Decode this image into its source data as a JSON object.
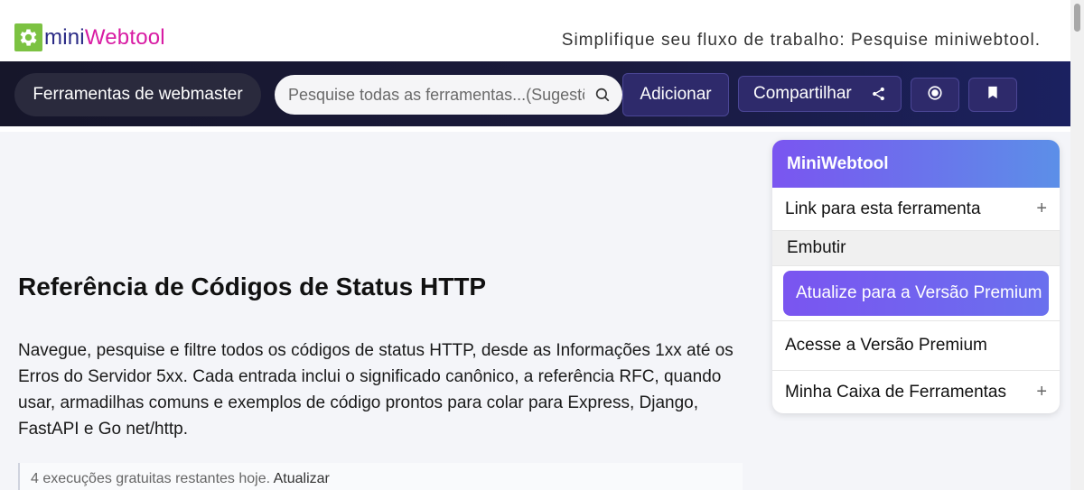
{
  "header": {
    "logo_mini": "mini",
    "logo_web": "Webtool",
    "tagline": "Simplifique seu fluxo de trabalho: Pesquise miniwebtool."
  },
  "navbar": {
    "category_label": "Ferramentas de webmaster",
    "search_placeholder": "Pesquise todas as ferramentas...(Sugestões)",
    "add_label": "Adicionar",
    "share_label": "Compartilhar"
  },
  "main": {
    "title": "Referência de Códigos de Status HTTP",
    "intro": "Navegue, pesquise e filtre todos os códigos de status HTTP, desde as Informações 1xx até os Erros do Servidor 5xx. Cada entrada inclui o significado canônico, a referência RFC, quando usar, armadilhas comuns e exemplos de código prontos para colar para Express, Django, FastAPI e Go net/http.",
    "notice_text": "4 execuções gratuitas restantes hoje.",
    "notice_link": "Atualizar"
  },
  "sidebar": {
    "title": "MiniWebtool",
    "link_label": "Link para esta ferramenta",
    "embed_label": "Embutir",
    "upgrade_label": "Atualize para a Versão Premium",
    "access_label": "Acesse a Versão Premium",
    "toolbox_label": "Minha Caixa de Ferramentas",
    "expand_symbol": "+"
  },
  "colors": {
    "logo_green": "#7cc242",
    "logo_mini": "#2b2b86",
    "logo_web": "#d81ba3",
    "nav_bg": "#16162a",
    "accent_purple": "#7a55f0",
    "accent_blue": "#5c8fe8"
  }
}
